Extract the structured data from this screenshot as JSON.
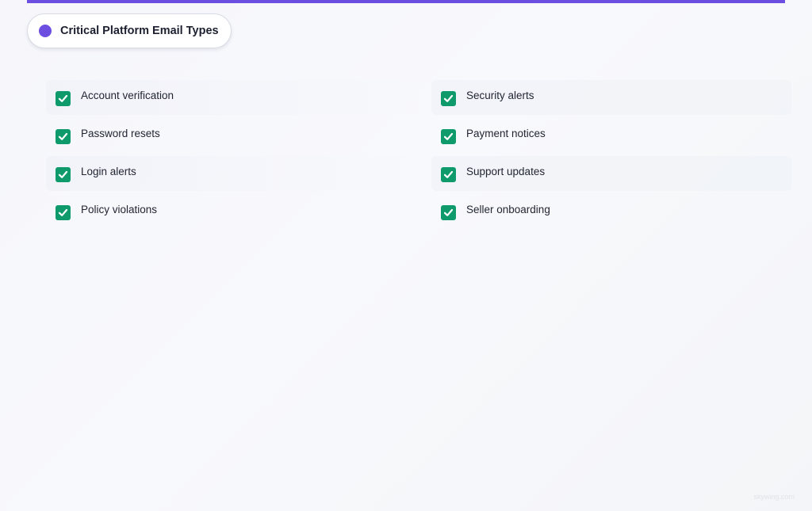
{
  "header": {
    "title": "Critical Platform Email Types",
    "accent_color": "#6c4fe0",
    "dot_icon": "circle-dot-icon"
  },
  "checklist": {
    "check_color": "#0f9a6b",
    "check_icon": "checkmark-icon",
    "items": [
      {
        "label": "Account verification",
        "checked": true
      },
      {
        "label": "Security alerts",
        "checked": true
      },
      {
        "label": "Password resets",
        "checked": true
      },
      {
        "label": "Payment notices",
        "checked": true
      },
      {
        "label": "Login alerts",
        "checked": true
      },
      {
        "label": "Support updates",
        "checked": true
      },
      {
        "label": "Policy violations",
        "checked": true
      },
      {
        "label": "Seller onboarding",
        "checked": true
      }
    ]
  },
  "footer": {
    "watermark": "skywing.com"
  }
}
